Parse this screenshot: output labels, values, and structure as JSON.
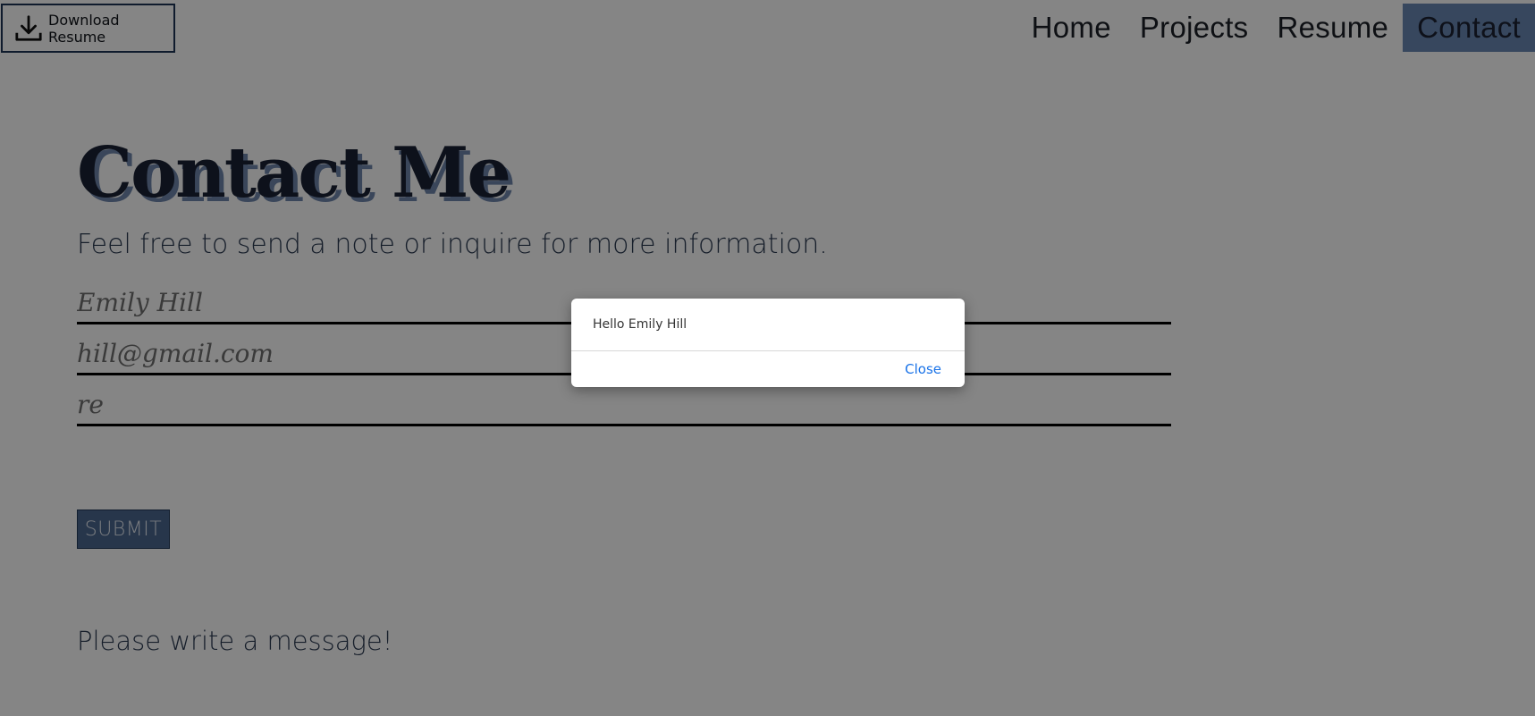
{
  "header": {
    "download_label": "Download Resume"
  },
  "nav": {
    "items": [
      {
        "label": "Home"
      },
      {
        "label": "Projects"
      },
      {
        "label": "Resume"
      },
      {
        "label": "Contact",
        "active": true
      }
    ]
  },
  "main": {
    "title": "Contact Me",
    "subtitle": "Feel free to send a note or inquire for more information.",
    "form": {
      "name_value": "Emily Hill",
      "email_value": "hill@gmail.com",
      "message_value": "re",
      "submit_label": "SUBMIT"
    },
    "note": "Please write a message!"
  },
  "dialog": {
    "message": "Hello Emily Hill",
    "close_label": "Close"
  },
  "colors": {
    "accent": "#6a89b4",
    "submit_bg": "#4c6891",
    "dialog_link": "#1a73e8",
    "overlay": "rgba(0,0,0,0.48)"
  }
}
